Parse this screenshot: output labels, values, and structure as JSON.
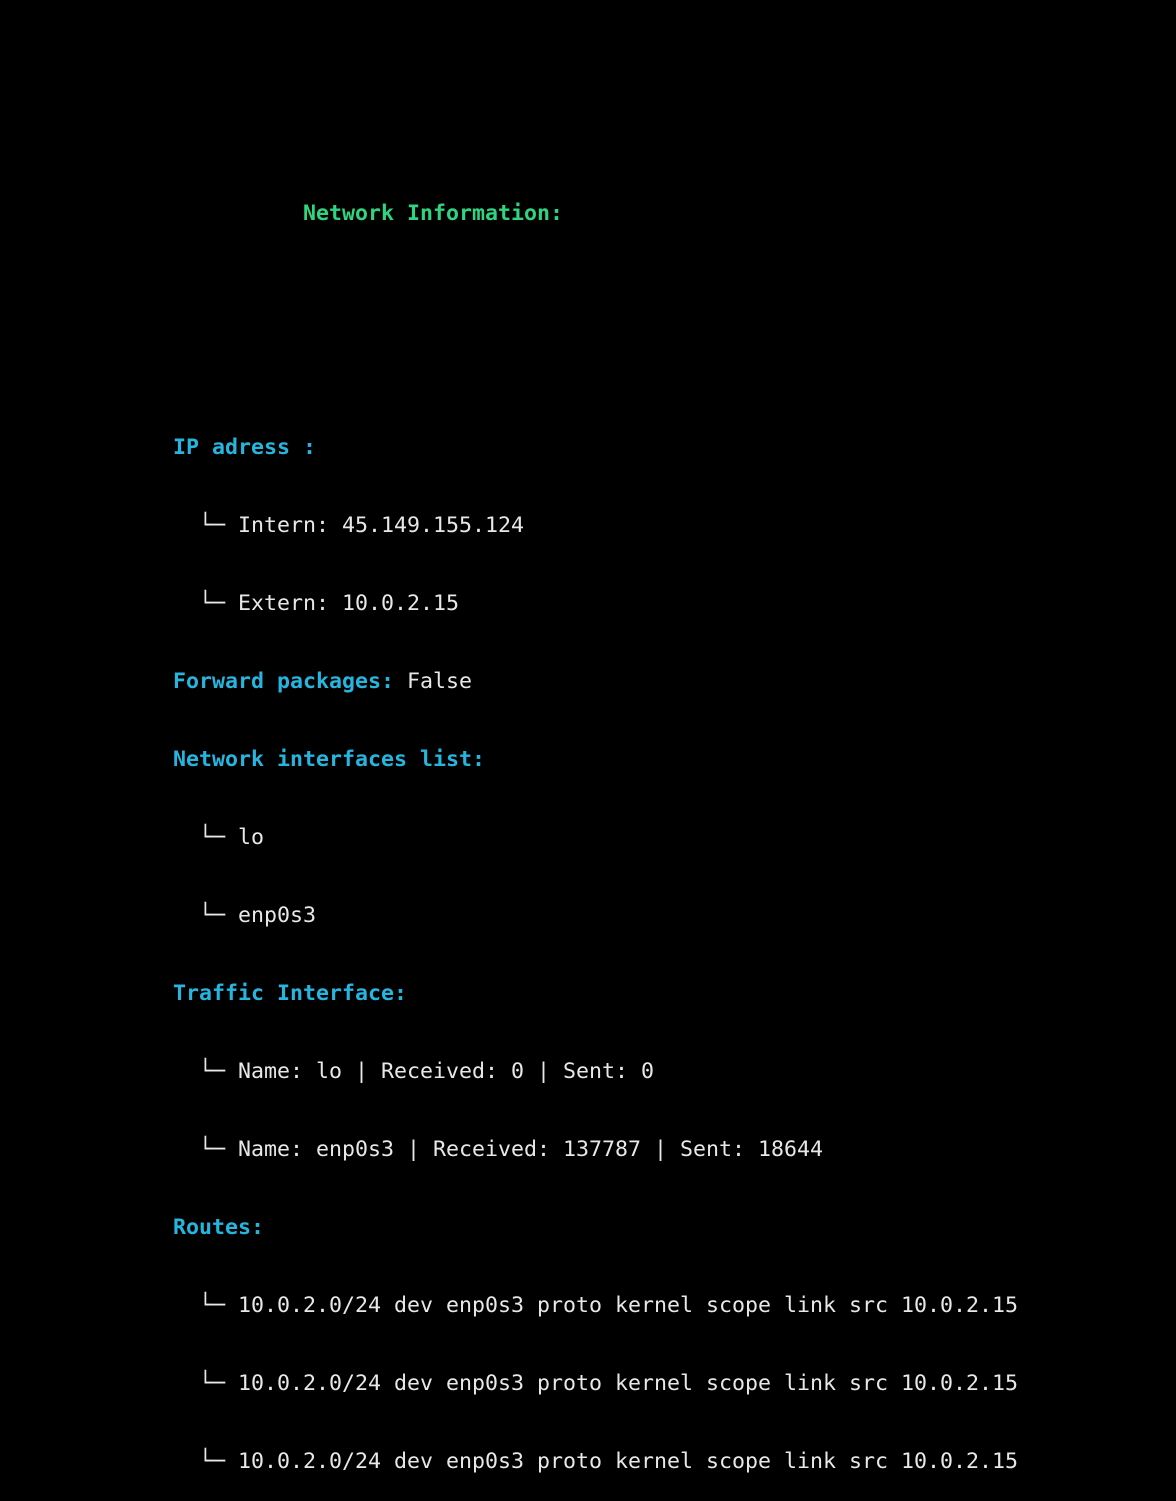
{
  "title": "Network Information:",
  "ip": {
    "label": "IP adress :",
    "items": [
      "Intern: 45.149.155.124",
      "Extern: 10.0.2.15"
    ]
  },
  "forward": {
    "label": "Forward packages:",
    "value": "False"
  },
  "interfaces": {
    "label": "Network interfaces list:",
    "items": [
      "lo",
      "enp0s3"
    ]
  },
  "traffic": {
    "label": "Traffic Interface:",
    "items": [
      "Name: lo | Received: 0 | Sent: 0",
      "Name: enp0s3 | Received: 137787 | Sent: 18644"
    ]
  },
  "routes": {
    "label": "Routes:",
    "items": [
      "10.0.2.0/24 dev enp0s3 proto kernel scope link src 10.0.2.15",
      "10.0.2.0/24 dev enp0s3 proto kernel scope link src 10.0.2.15",
      "10.0.2.0/24 dev enp0s3 proto kernel scope link src 10.0.2.15"
    ]
  },
  "tree_glyph": "  └─ ",
  "colors": {
    "title": "#2ed47f",
    "key": "#26b5df",
    "text": "#e8e8e8",
    "background": "#000000"
  }
}
